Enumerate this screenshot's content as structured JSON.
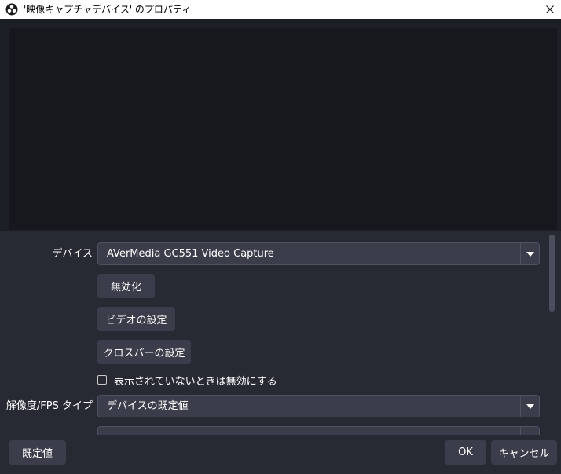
{
  "window": {
    "title": "'映像キャプチャデバイス' のプロパティ"
  },
  "properties": {
    "device_label": "デバイス",
    "device_value": "AVerMedia GC551 Video Capture",
    "deactivate_label": "無効化",
    "video_settings_label": "ビデオの設定",
    "crossbar_settings_label": "クロスバーの設定",
    "hide_deactivate_label": "表示されていないときは無効にする",
    "hide_deactivate_checked": false,
    "res_fps_label": "解像度/FPS タイプ",
    "res_fps_value": "デバイスの既定値"
  },
  "footer": {
    "defaults_label": "既定値",
    "ok_label": "OK",
    "cancel_label": "キャンセル"
  },
  "colors": {
    "window_bg": "#272a33",
    "preview_bg": "#17181d",
    "control_bg": "#3b3e4a",
    "titlebar_bg": "#ffffff"
  },
  "icons": {
    "app": "obs-logo-icon",
    "close": "close-icon",
    "dropdown": "triangle-down-icon"
  }
}
